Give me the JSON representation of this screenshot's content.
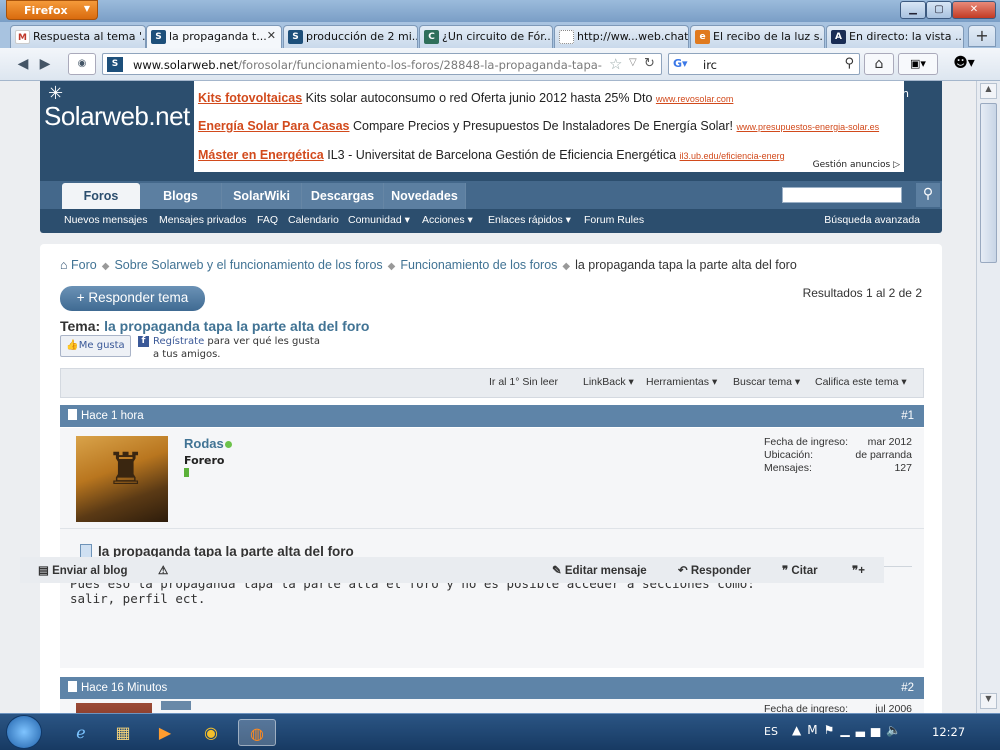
{
  "browser": {
    "app_button": "Firefox",
    "tabs": [
      {
        "label": "Respuesta al tema '...",
        "icon": "gmail-icon",
        "color": "#c0392b",
        "glyph": "M"
      },
      {
        "label": "la propaganda t...",
        "icon": "solarweb-icon",
        "color": "#1d4f7a",
        "glyph": "S",
        "active": true
      },
      {
        "label": "producción de 2 mi...",
        "icon": "solarweb-icon",
        "color": "#1d4f7a",
        "glyph": "S"
      },
      {
        "label": "¿Un circuito de Fór...",
        "icon": "site-icon",
        "color": "#2f6f5a",
        "glyph": "C"
      },
      {
        "label": "http://ww...web.chat",
        "icon": "blank-page-icon",
        "color": "#ffffff",
        "glyph": ""
      },
      {
        "label": "El recibo de la luz s...",
        "icon": "el-confidencial-icon",
        "color": "#e07a1f",
        "glyph": "e"
      },
      {
        "label": "En directo: la vista ...",
        "icon": "abc-icon",
        "color": "#1a2d55",
        "glyph": "A"
      }
    ],
    "url_domain": "www.solarweb.net",
    "url_path": "/forosolar/funcionamiento-los-foros/28848-la-propaganda-tapa-la-part",
    "search_query": "irc"
  },
  "site": {
    "logo": "Solarweb.net",
    "ads": [
      {
        "title": "Kits fotovoltaicas",
        "text": "Kits solar autoconsumo o red Oferta junio 2012 hasta 25% Dto",
        "url": "www.revosolar.com"
      },
      {
        "title": "Energía Solar Para Casas",
        "text": "Compare Precios y Presupuestos De Instaladores De Energía Solar!",
        "url": "www.presupuestos-energia-solar.es"
      },
      {
        "title": "Máster en Energética",
        "text": "IL3 - Universitat de Barcelona Gestión de Eficiencia Energética",
        "url": "il3.ub.edu/eficiencia-energ"
      }
    ],
    "ad_manage": "Gestión anuncios ▷",
    "nav_tabs": [
      "Foros",
      "Blogs",
      "SolarWiki",
      "Descargas",
      "Novedades"
    ],
    "subnav": [
      "Nuevos mensajes",
      "Mensajes privados",
      "FAQ",
      "Calendario",
      "Comunidad ▾",
      "Acciones ▾",
      "Enlaces rápidos ▾",
      "Forum Rules"
    ],
    "advanced_search": "Búsqueda avanzada"
  },
  "thread": {
    "breadcrumb": [
      "Foro",
      "Sobre Solarweb y el funcionamiento de los foros",
      "Funcionamiento de los foros"
    ],
    "breadcrumb_current": "la propaganda tapa la parte alta del foro",
    "reply_button": "+ Responder tema",
    "results": "Resultados 1 al 2 de 2",
    "title_prefix": "Tema:",
    "title": "la propaganda tapa la parte alta del foro",
    "like_button": "Me gusta",
    "fb_link": "Regístrate",
    "fb_text": " para ver qué les gusta a tus amigos.",
    "tools": [
      "Ir al 1° Sin leer",
      "LinkBack ▾",
      "Herramientas ▾",
      "Buscar tema ▾",
      "Califica este tema ▾"
    ]
  },
  "posts": [
    {
      "time": "Hace 1 hora",
      "number": "#1",
      "username": "Rodas",
      "rank": "Forero",
      "info_keys": [
        "Fecha de ingreso:",
        "Ubicación:",
        "Mensajes:"
      ],
      "info_values": [
        "mar 2012",
        "de parranda",
        "127"
      ],
      "title": "la propaganda tapa la parte alta del foro",
      "body": "Pues eso la propaganda tapa la parte alta el foro y no es posible acceder a secciones como:\nsalir, perfil ect.",
      "actions": [
        "Enviar al blog",
        "Editar mensaje",
        "Responder",
        "Citar"
      ]
    },
    {
      "time": "Hace 16 Minutos",
      "number": "#2",
      "info_key": "Fecha de ingreso:",
      "info_value": "jul 2006"
    }
  ],
  "taskbar": {
    "language": "ES",
    "clock": "12:27"
  }
}
